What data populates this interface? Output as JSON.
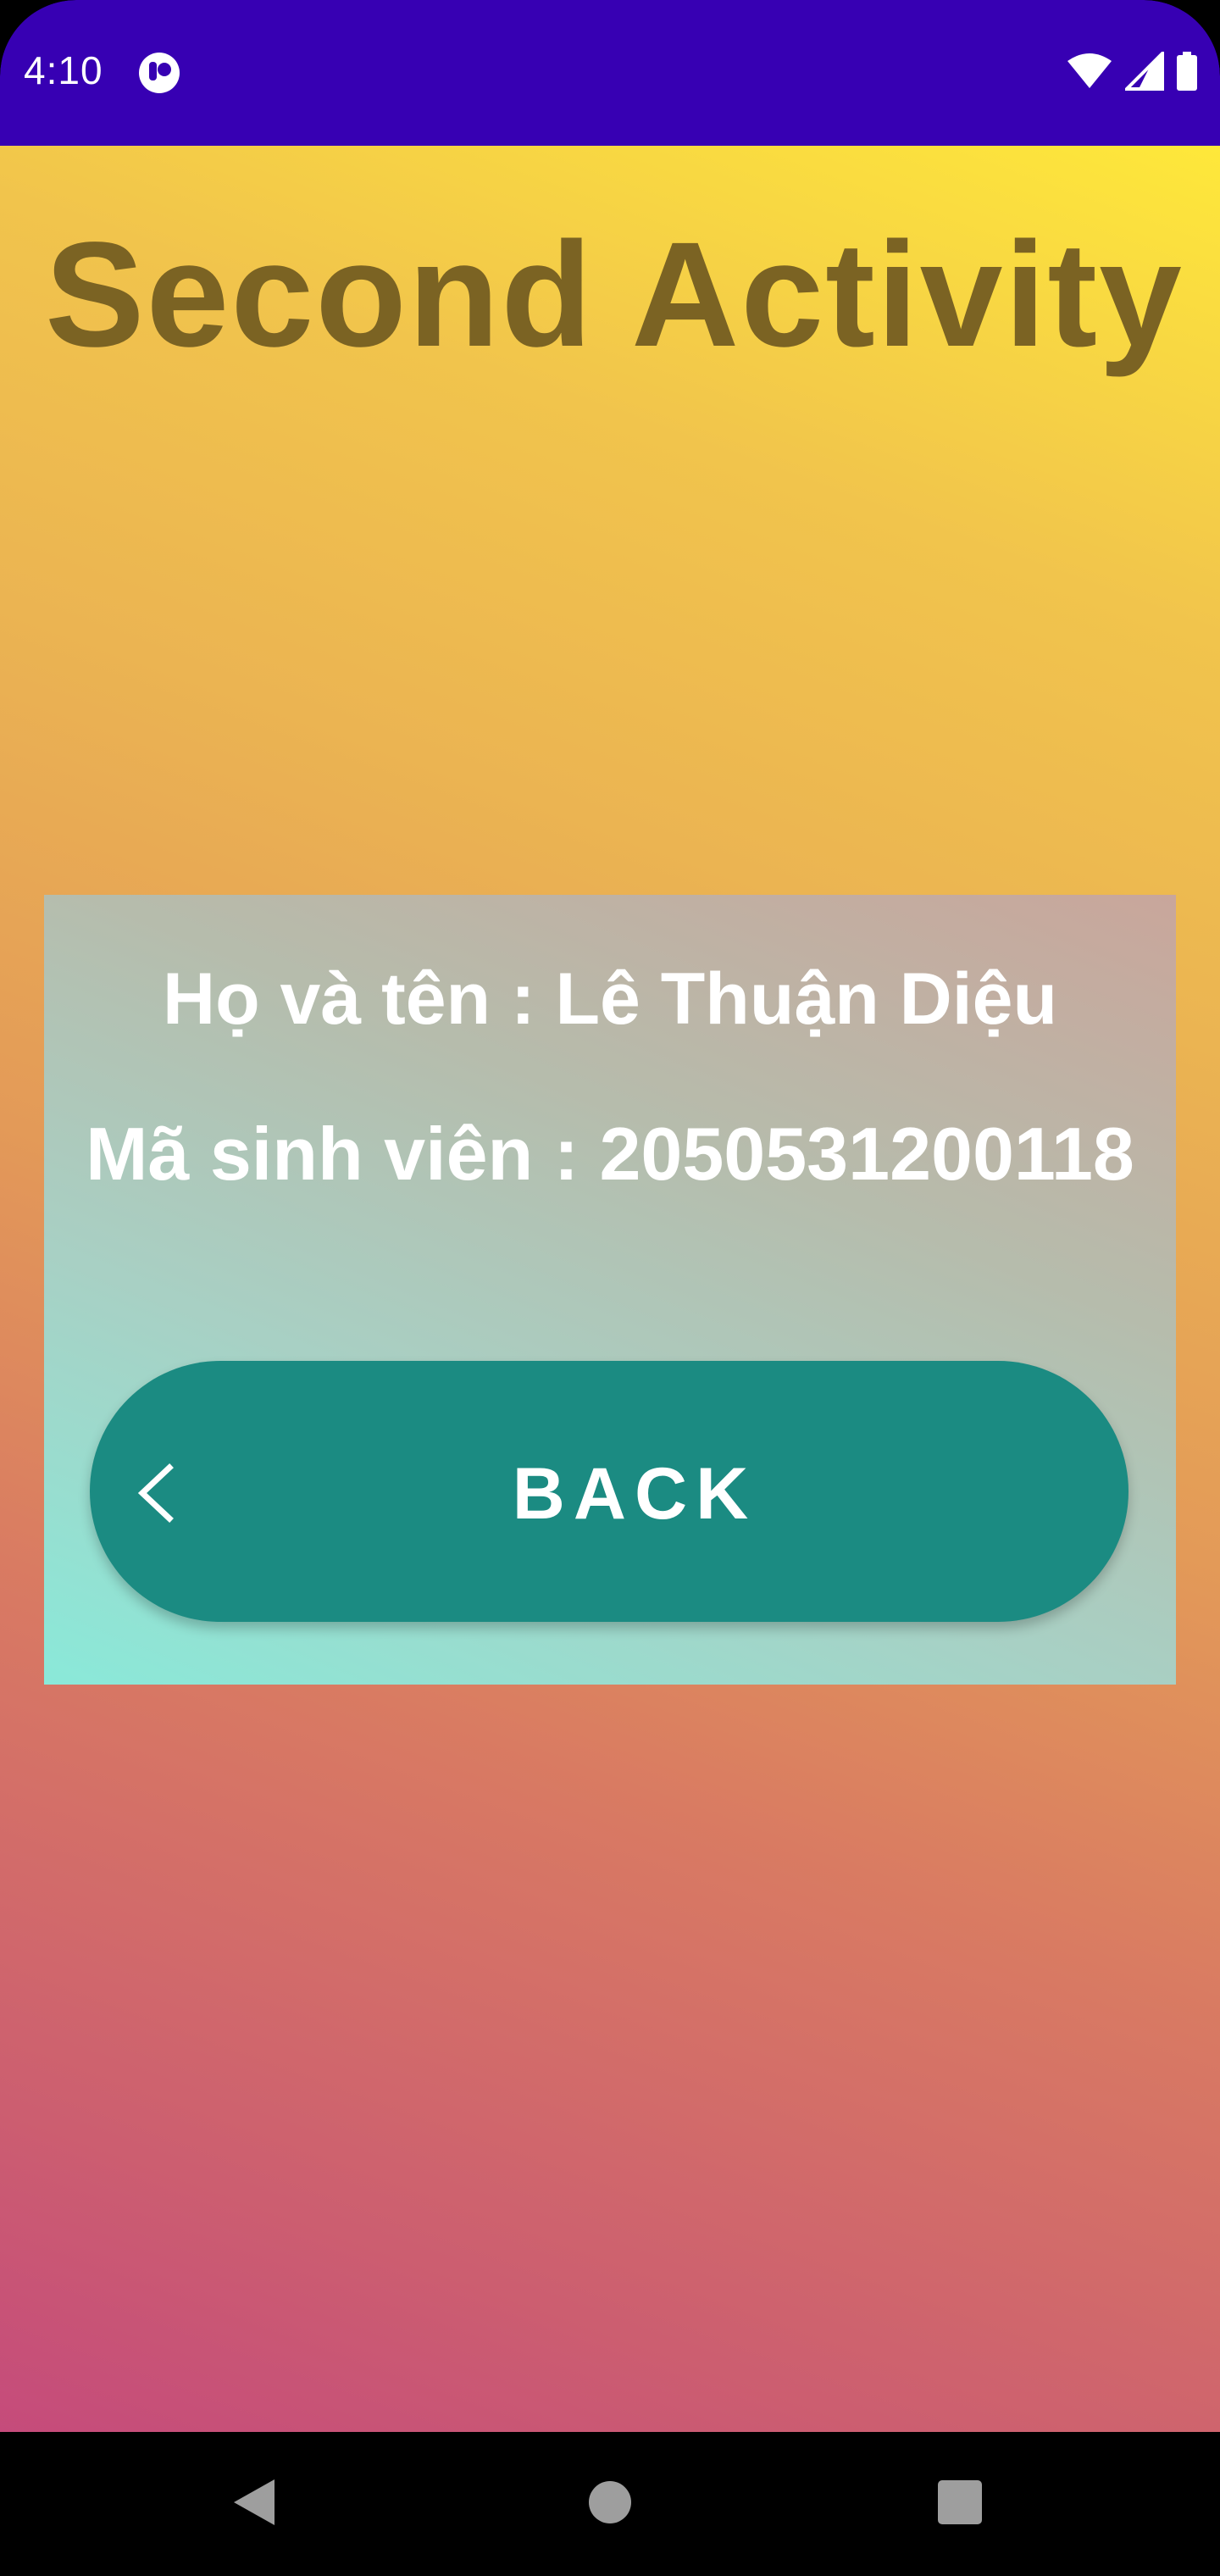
{
  "status_bar": {
    "time": "4:10",
    "app_icon": "notification-app-icon",
    "icons": [
      "wifi-icon",
      "signal-icon",
      "battery-icon"
    ],
    "background": "#3700b3"
  },
  "screen": {
    "title": "Second Activity",
    "title_color": "#7b6323"
  },
  "card": {
    "name_line": "Họ và tên : Lê Thuận Diệu",
    "student_id_line": "Mã sinh viên : 2050531200118"
  },
  "back_button": {
    "label": "BACK",
    "icon": "chevron-left-icon",
    "color": "#1b8b82"
  },
  "nav_bar": {
    "buttons": [
      "back-triangle-icon",
      "home-circle-icon",
      "recents-square-icon"
    ]
  }
}
